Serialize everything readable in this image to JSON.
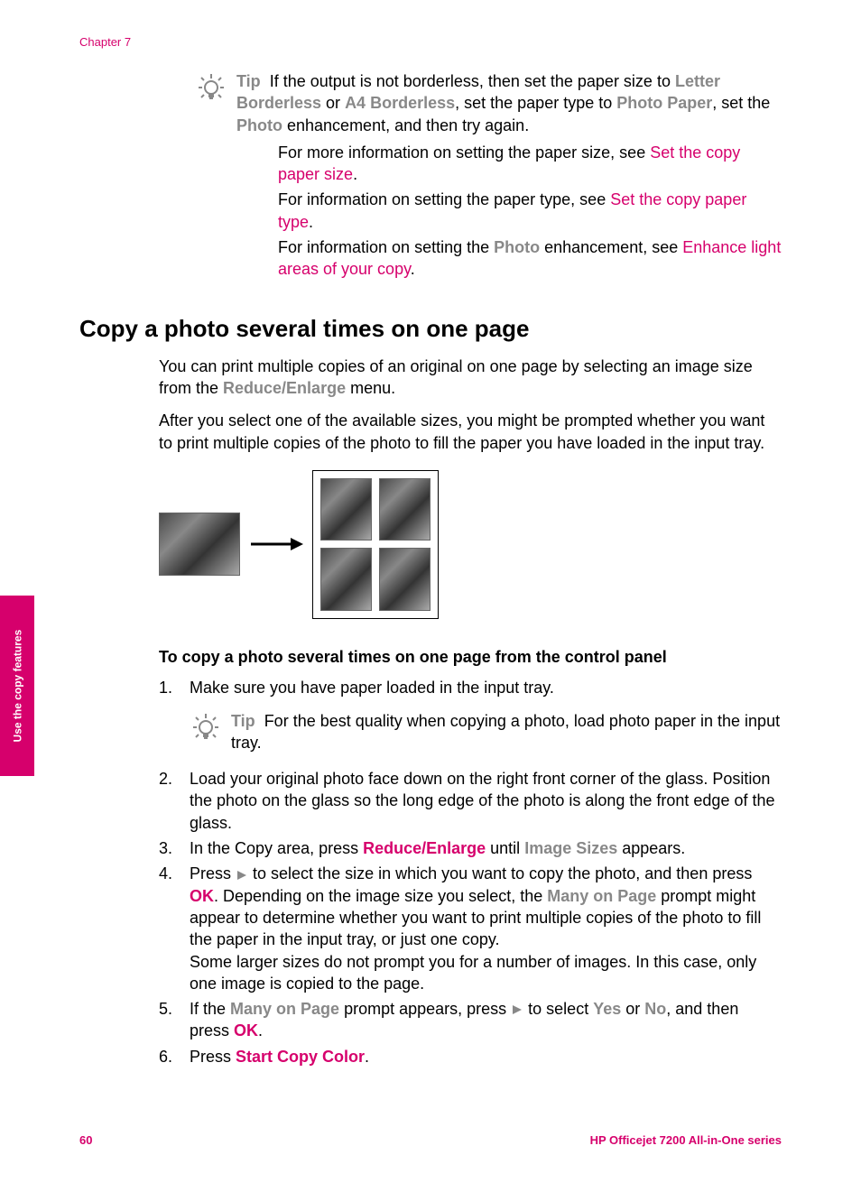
{
  "chapter": "Chapter 7",
  "tip1": {
    "label": "Tip",
    "text1_a": "If the output is not borderless, then set the paper size to ",
    "letter_borderless": "Letter Borderless",
    "or": " or ",
    "a4_borderless": "A4 Borderless",
    "text1_b": ", set the paper type to ",
    "photo_paper": "Photo Paper",
    "text1_c": ", set the ",
    "photo": "Photo",
    "text1_d": " enhancement, and then try again.",
    "info1_a": "For more information on setting the paper size, see ",
    "info1_link": "Set the copy paper size",
    "info2_a": "For information on setting the paper type, see ",
    "info2_link": "Set the copy paper type",
    "info3_a": "For information on setting the ",
    "info3_photo": "Photo",
    "info3_b": " enhancement, see ",
    "info3_link": "Enhance light areas of your copy"
  },
  "heading": "Copy a photo several times on one page",
  "para1_a": "You can print multiple copies of an original on one page by selecting an image size from the ",
  "para1_menu": "Reduce/Enlarge",
  "para1_b": " menu.",
  "para2": "After you select one of the available sizes, you might be prompted whether you want to print multiple copies of the photo to fill the paper you have loaded in the input tray.",
  "subheading": "To copy a photo several times on one page from the control panel",
  "steps": {
    "s1": "Make sure you have paper loaded in the input tray.",
    "tip2_label": "Tip",
    "tip2_text": "For the best quality when copying a photo, load photo paper in the input tray.",
    "s2": "Load your original photo face down on the right front corner of the glass. Position the photo on the glass so the long edge of the photo is along the front edge of the glass.",
    "s3_a": "In the Copy area, press ",
    "s3_btn": "Reduce/Enlarge",
    "s3_b": " until ",
    "s3_gray": "Image Sizes",
    "s3_c": " appears.",
    "s4_a": "Press ",
    "s4_b": " to select the size in which you want to copy the photo, and then press ",
    "s4_ok": "OK",
    "s4_c": ". Depending on the image size you select, the ",
    "s4_gray": "Many on Page",
    "s4_d": " prompt might appear to determine whether you want to print multiple copies of the photo to fill the paper in the input tray, or just one copy.",
    "s4_e": "Some larger sizes do not prompt you for a number of images. In this case, only one image is copied to the page.",
    "s5_a": "If the ",
    "s5_gray": "Many on Page",
    "s5_b": " prompt appears, press ",
    "s5_c": " to select ",
    "s5_yes": "Yes",
    "s5_or": " or ",
    "s5_no": "No",
    "s5_d": ", and then press ",
    "s5_ok": "OK",
    "s6_a": "Press ",
    "s6_btn": "Start Copy Color"
  },
  "sidetab": "Use the copy features",
  "footer": {
    "page": "60",
    "title": "HP Officejet 7200 All-in-One series"
  }
}
